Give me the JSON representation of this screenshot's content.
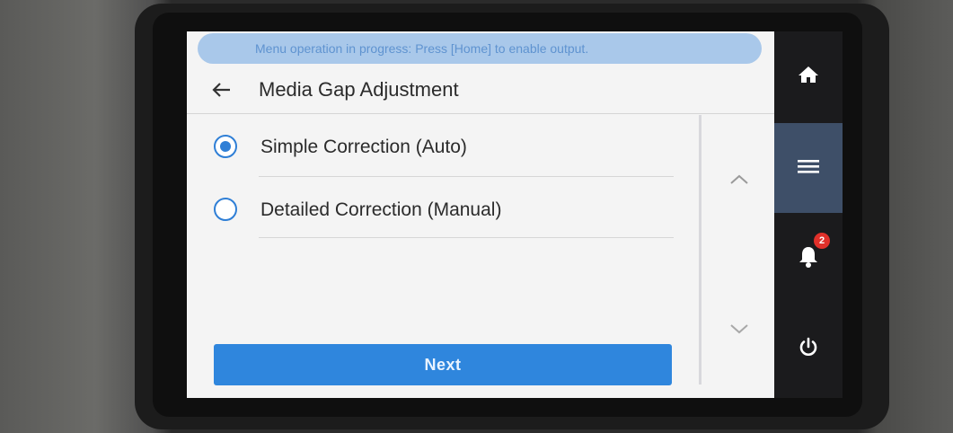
{
  "banner": {
    "text": "Menu operation in progress: Press [Home] to enable output."
  },
  "header": {
    "title": "Media Gap Adjustment",
    "back_icon": "arrow-left-icon"
  },
  "options": [
    {
      "label": "Simple Correction (Auto)",
      "selected": true
    },
    {
      "label": "Detailed Correction (Manual)",
      "selected": false
    }
  ],
  "scroll": {
    "up_icon": "chevron-up-icon",
    "down_icon": "chevron-down-icon"
  },
  "footer": {
    "next_label": "Next"
  },
  "nav": {
    "home_icon": "home-icon",
    "menu_icon": "menu-icon",
    "notifications_icon": "bell-icon",
    "notification_count": "2",
    "power_icon": "power-icon"
  },
  "colors": {
    "accent": "#2f86dd",
    "radio": "#2f7fd6",
    "banner_bg": "#a9c8ea",
    "banner_text": "#5f93d0",
    "nav_bg": "#1b1b1d",
    "nav_active": "#3e4f68",
    "badge": "#e0302a"
  }
}
